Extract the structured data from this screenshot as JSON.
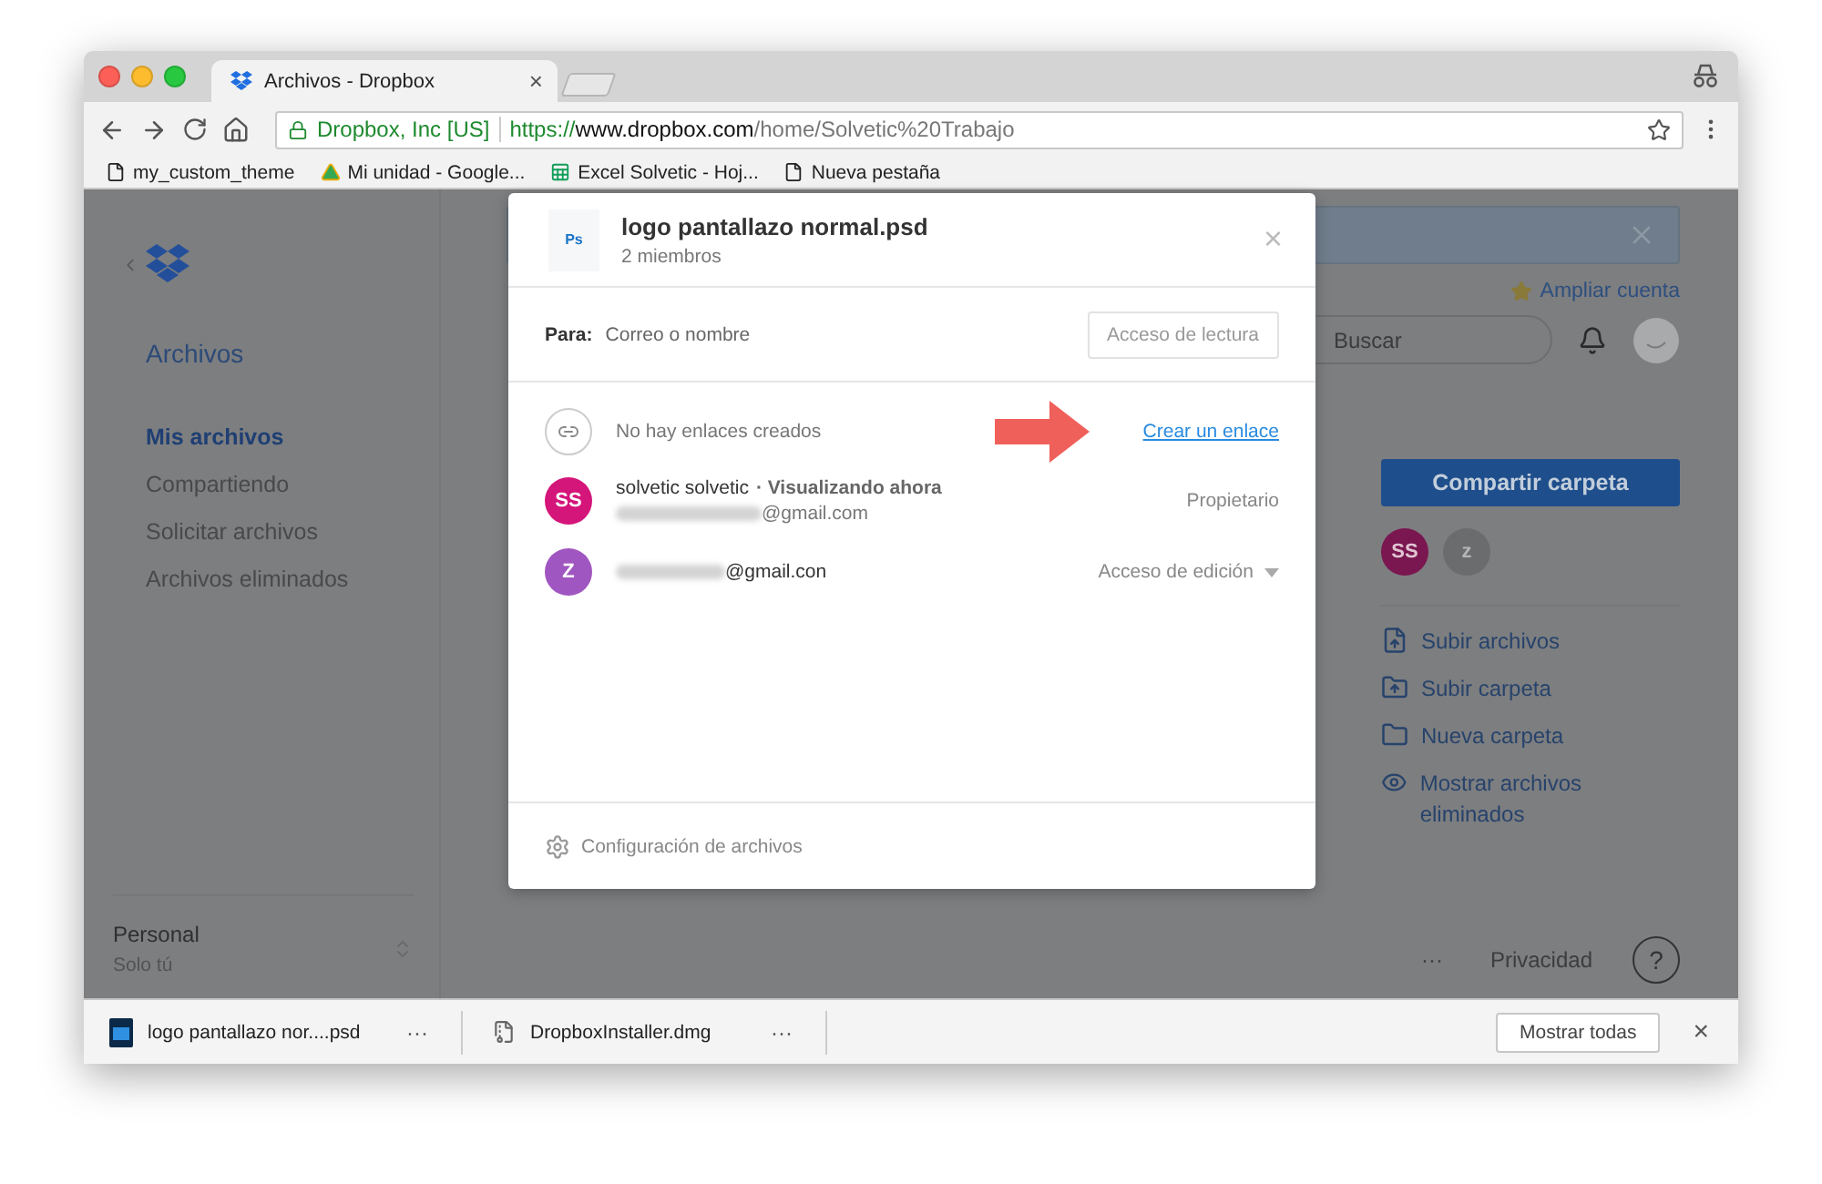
{
  "browser": {
    "tab": {
      "title": "Archivos - Dropbox",
      "close": "×"
    },
    "address": {
      "secure": true,
      "site": "Dropbox, Inc [US]",
      "scheme": "https://",
      "host": "www.dropbox.com",
      "path": "/home/Solvetic%20Trabajo"
    },
    "bookmarks": [
      {
        "label": "my_custom_theme",
        "kind": "page"
      },
      {
        "label": "Mi unidad - Google...",
        "kind": "drive"
      },
      {
        "label": "Excel Solvetic - Hoj...",
        "kind": "sheet"
      },
      {
        "label": "Nueva pestaña",
        "kind": "page"
      }
    ]
  },
  "sidebar": {
    "section": "Archivos",
    "items": [
      {
        "label": "Mis archivos",
        "selected": true
      },
      {
        "label": "Compartiendo",
        "selected": false
      },
      {
        "label": "Solicitar archivos",
        "selected": false
      },
      {
        "label": "Archivos eliminados",
        "selected": false
      }
    ],
    "account": {
      "name": "Personal",
      "note": "Solo tú"
    }
  },
  "topbar": {
    "upgrade": "Ampliar cuenta",
    "search": {
      "placeholder": "Buscar"
    }
  },
  "folder_panel": {
    "share_button": "Compartir carpeta",
    "members": [
      {
        "initials": "SS",
        "color": "#7a1650"
      },
      {
        "initials": "z",
        "color": "#6b6c6e"
      }
    ],
    "actions": [
      {
        "label": "Subir archivos",
        "kind": "upload-file"
      },
      {
        "label": "Subir carpeta",
        "kind": "upload-folder"
      },
      {
        "label": "Nueva carpeta",
        "kind": "folder"
      },
      {
        "label": "Mostrar archivos eliminados",
        "kind": "eye"
      }
    ]
  },
  "footer": {
    "more": "···",
    "privacy": "Privacidad",
    "help": "?"
  },
  "share_dialog": {
    "file_badge": "Ps",
    "title": "logo pantallazo normal.psd",
    "subtitle": "2 miembros",
    "close": "×",
    "to_label": "Para:",
    "to_placeholder": "Correo o nombre",
    "access_button": "Acceso de lectura",
    "links_status": "No hay enlaces creados",
    "create_link": "Crear un enlace",
    "members": [
      {
        "initials": "SS",
        "color": "#d4157a",
        "name": "solvetic solvetic",
        "status": "· Visualizando ahora",
        "email": "@gmail.com",
        "role": "Propietario",
        "role_menu": false
      },
      {
        "initials": "Z",
        "color": "#a056c0",
        "email": "@gmail.con",
        "role": "Acceso de edición",
        "role_menu": true
      }
    ],
    "settings": "Configuración de archivos"
  },
  "downloads": {
    "items": [
      {
        "name": "logo pantallazo nor....psd",
        "kind": "psd",
        "more": "···"
      },
      {
        "name": "DropboxInstaller.dmg",
        "kind": "dmg",
        "more": "···"
      }
    ],
    "show_all": "Mostrar todas",
    "close": "×"
  }
}
